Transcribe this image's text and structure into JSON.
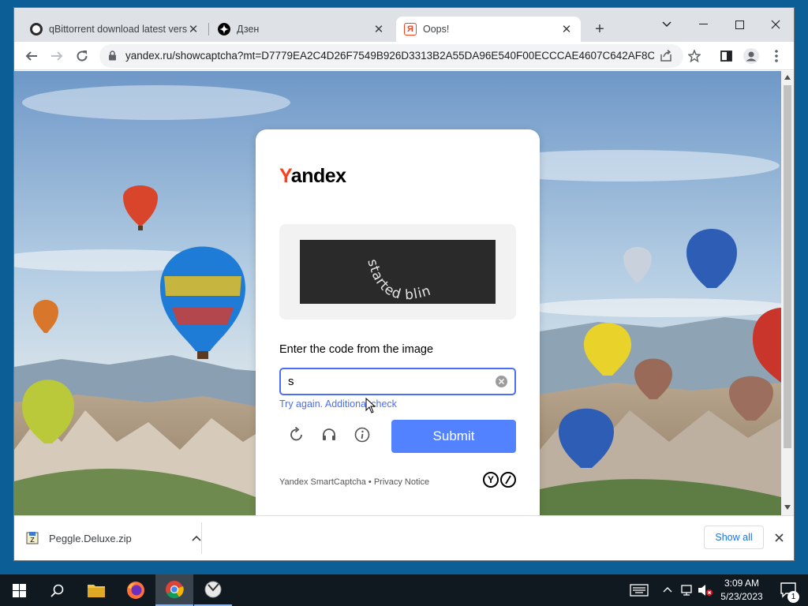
{
  "browser": {
    "tabs": [
      {
        "title": "qBittorrent download latest versi",
        "active": false
      },
      {
        "title": "Дзен",
        "active": false
      },
      {
        "title": "Oops!",
        "active": true
      }
    ],
    "url": "yandex.ru/showcaptcha?mt=D7779EA2C4D26F7549B926D3313B2A55DA96E540F00ECCCAE4607C642AF8C..."
  },
  "captcha": {
    "logo_first": "Y",
    "logo_rest": "andex",
    "image_text": "started blink",
    "prompt": "Enter the code from the image",
    "input_value": "s",
    "error": "Try again. Additional check",
    "submit_label": "Submit",
    "footer": "Yandex SmartCaptcha • Privacy Notice",
    "accent_color": "#5282ff",
    "brand_color": "#fc3f1d"
  },
  "downloads": {
    "file_name": "Peggle.Deluxe.zip",
    "show_all": "Show all"
  },
  "taskbar": {
    "time": "3:09 AM",
    "date": "5/23/2023",
    "notification_count": "1"
  }
}
